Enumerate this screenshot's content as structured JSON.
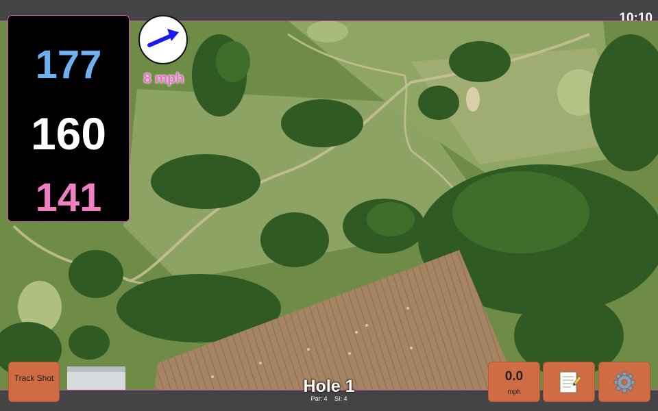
{
  "status": {
    "time": "10:10"
  },
  "distances": {
    "back": "177",
    "middle": "160",
    "front": "141"
  },
  "wind": {
    "speed_label": "8 mph",
    "icon": "wind-arrow-icon"
  },
  "hole": {
    "title": "Hole 1",
    "par": "Par: 4",
    "stroke_index": "SI: 4"
  },
  "buttons": {
    "track_shot": "Track Shot",
    "speed_value": "0.0",
    "speed_unit": "mph",
    "notes_icon": "notepad-icon",
    "settings_icon": "gear-icon"
  },
  "colors": {
    "back_distance": "#6eb0f0",
    "middle_distance": "#ffffff",
    "front_distance": "#ef7fc1",
    "button": "#d06c43",
    "wind_arrow": "#1a1aee",
    "wind_label": "#f06ad0"
  }
}
